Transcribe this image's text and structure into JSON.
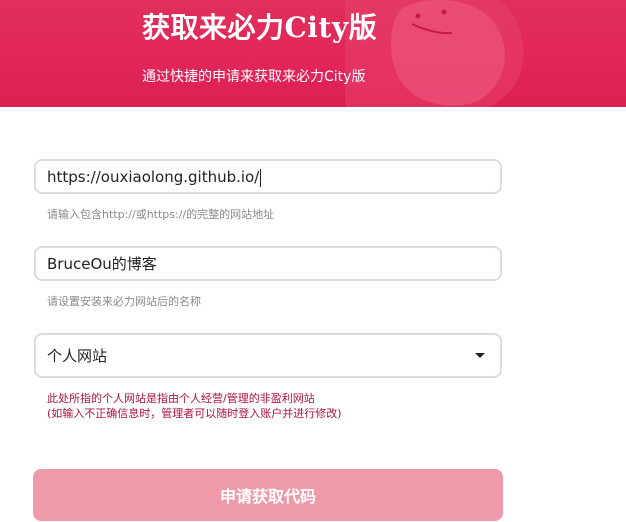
{
  "header": {
    "title": "获取来必力City版",
    "subtitle": "通过快捷的申请来获取来必力City版",
    "background_color": "#e2265a"
  },
  "form": {
    "website_url": {
      "value": "https://ouxiaolong.github.io/",
      "hint": "请输入包含http://或https://的完整的网站地址"
    },
    "site_name": {
      "value": "BruceOu的博客",
      "hint": "请设置安装来必力网站后的名称"
    },
    "site_type": {
      "selected": "个人网站",
      "note_line1": "此处所指的个人网站是指由个人经营/管理的非盈利网站",
      "note_line2": "(如输入不正确信息时，管理者可以随时登入账户并进行修改)",
      "note_color": "#b0123e"
    },
    "submit": {
      "label": "申请获取代码",
      "color": "#ee9aab"
    }
  }
}
